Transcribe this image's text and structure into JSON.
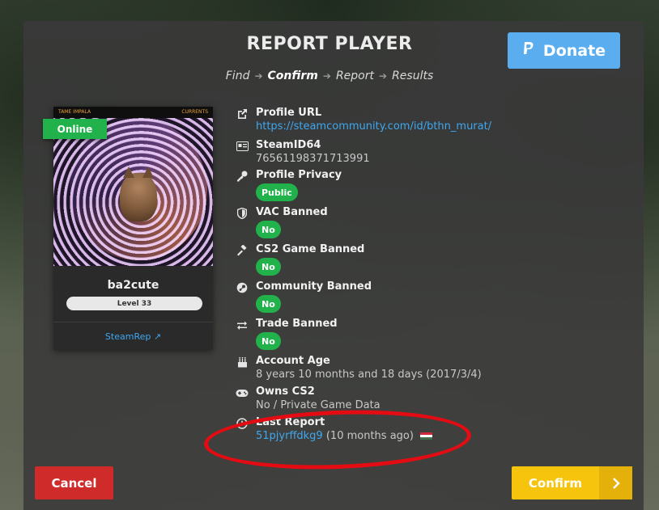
{
  "header": {
    "title": "REPORT PLAYER",
    "donate_label": "Donate",
    "donate_icon": "paypal-icon"
  },
  "steps": [
    {
      "label": "Find",
      "active": false
    },
    {
      "label": "Confirm",
      "active": true
    },
    {
      "label": "Report",
      "active": false
    },
    {
      "label": "Results",
      "active": false
    }
  ],
  "profile": {
    "status": "Online",
    "album_left": "TAME IMPALA",
    "album_right": "CURRENTS",
    "username": "ba2cute",
    "level": "Level 33",
    "steamrep_label": "SteamRep"
  },
  "details": {
    "profile_url": {
      "label": "Profile URL",
      "value": "https://steamcommunity.com/id/bthn_murat/"
    },
    "steamid64": {
      "label": "SteamID64",
      "value": "76561198371713991"
    },
    "privacy": {
      "label": "Profile Privacy",
      "value": "Public"
    },
    "vac": {
      "label": "VAC Banned",
      "value": "No"
    },
    "game_ban": {
      "label": "CS2 Game Banned",
      "value": "No"
    },
    "community_ban": {
      "label": "Community Banned",
      "value": "No"
    },
    "trade_ban": {
      "label": "Trade Banned",
      "value": "No"
    },
    "account_age": {
      "label": "Account Age",
      "value": "8 years 10 months and 18 days (2017/3/4)"
    },
    "owns_cs2": {
      "label": "Owns CS2",
      "value": "No / Private Game Data"
    },
    "last_report": {
      "label": "Last Report",
      "link": "51pjyrffdkg9",
      "suffix": "(10 months ago)"
    }
  },
  "actions": {
    "cancel_label": "Cancel",
    "confirm_label": "Confirm"
  },
  "colors": {
    "accent_blue": "#5aaef0",
    "success_green": "#22b24c",
    "danger_red": "#cf2b2b",
    "confirm_yellow": "#f6c40c",
    "annotation_red": "#e40c12"
  }
}
